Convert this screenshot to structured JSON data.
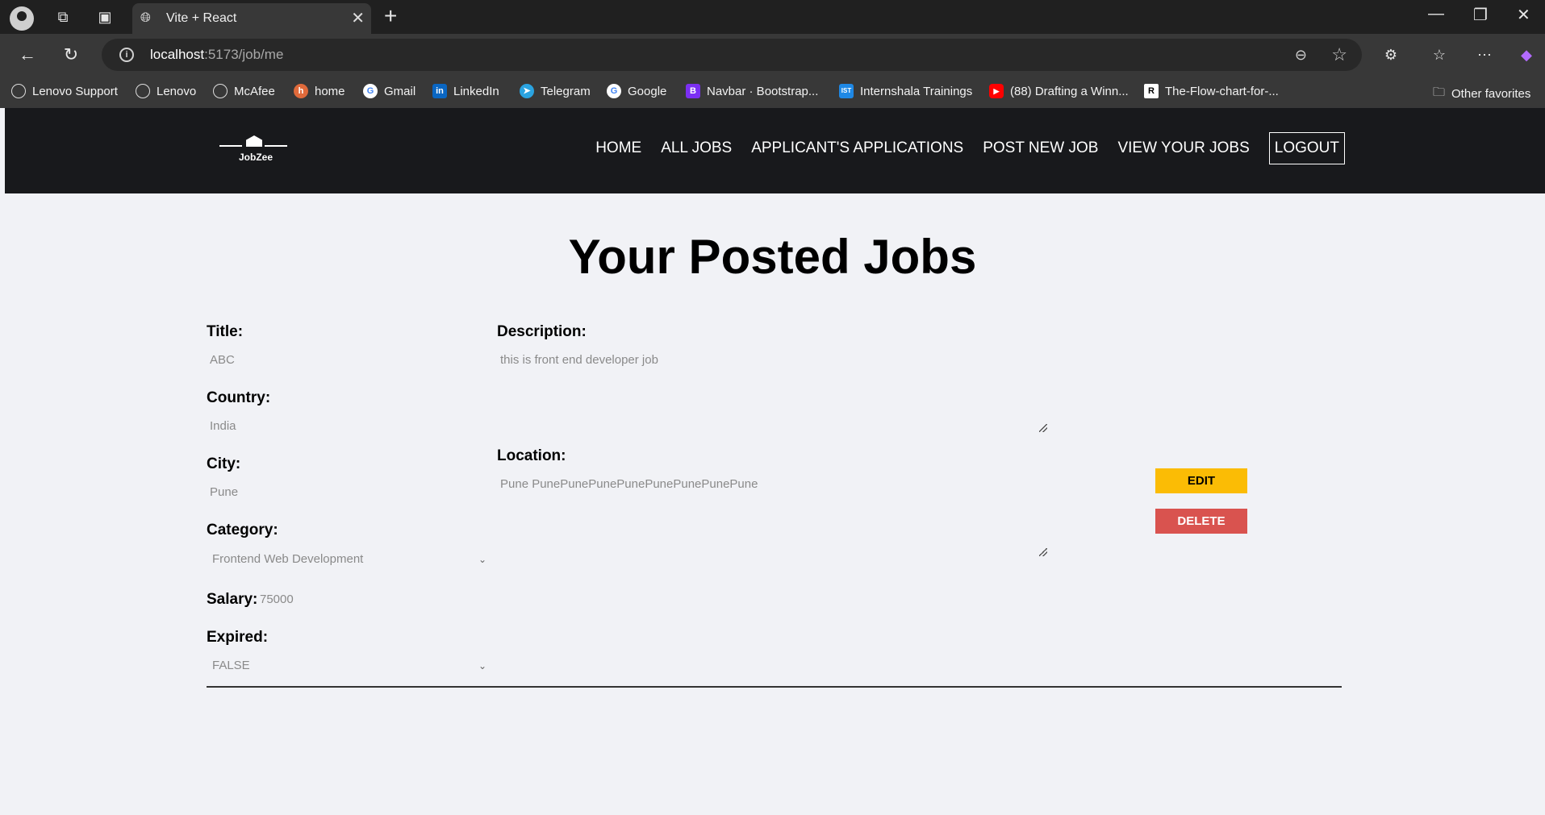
{
  "browser": {
    "tab_title": "Vite + React",
    "url_host": "localhost",
    "url_path": ":5173/job/me",
    "bookmarks": [
      {
        "label": "Lenovo Support",
        "icon": "globe-icon"
      },
      {
        "label": "Lenovo",
        "icon": "globe-icon"
      },
      {
        "label": "McAfee",
        "icon": "globe-icon"
      },
      {
        "label": "home",
        "icon": "home-favicon"
      },
      {
        "label": "Gmail",
        "icon": "google-icon"
      },
      {
        "label": "LinkedIn",
        "icon": "linkedin-icon"
      },
      {
        "label": "Telegram",
        "icon": "telegram-icon"
      },
      {
        "label": "Google",
        "icon": "google-icon"
      },
      {
        "label": "Navbar · Bootstrap...",
        "icon": "bootstrap-icon"
      },
      {
        "label": "Internshala Trainings",
        "icon": "internshala-icon"
      },
      {
        "label": "(88) Drafting a Winn...",
        "icon": "youtube-icon"
      },
      {
        "label": "The-Flow-chart-for-...",
        "icon": "doc-icon"
      }
    ],
    "other_favorites": "Other favorites"
  },
  "nav": {
    "logo_text": "JobZee",
    "links": [
      "HOME",
      "ALL JOBS",
      "APPLICANT'S APPLICATIONS",
      "POST NEW JOB",
      "VIEW YOUR JOBS"
    ],
    "logout": "LOGOUT"
  },
  "page": {
    "title": "Your Posted Jobs"
  },
  "job": {
    "title_label": "Title:",
    "title_value": "ABC",
    "country_label": "Country:",
    "country_value": "India",
    "city_label": "City:",
    "city_value": "Pune",
    "category_label": "Category:",
    "category_value": "Frontend Web Development",
    "salary_label": "Salary:",
    "salary_value": "75000",
    "expired_label": "Expired:",
    "expired_value": "FALSE",
    "description_label": "Description:",
    "description_value": "this is front end developer job",
    "location_label": "Location:",
    "location_value": "Pune PunePunePunePunePunePunePunePune",
    "edit_label": "EDIT",
    "delete_label": "DELETE"
  },
  "colors": {
    "nav_bg": "#18191c",
    "page_bg": "#f1f2f6",
    "edit_btn": "#fbbc05",
    "delete_btn": "#d9534f"
  }
}
